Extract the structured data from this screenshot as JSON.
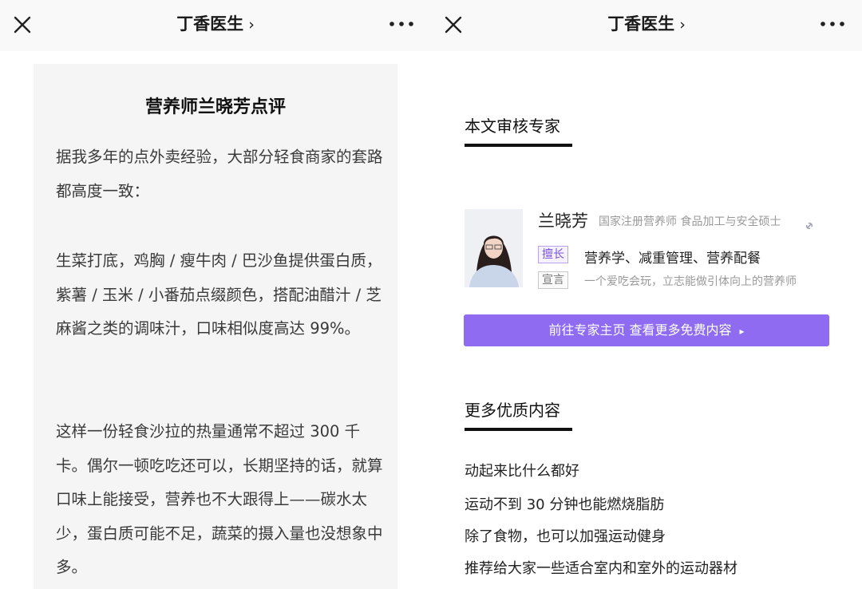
{
  "left_panel": {
    "header": {
      "title": "丁香医生",
      "chevron": "›"
    },
    "article": {
      "title": "营养师兰晓芳点评",
      "paragraphs": [
        "据我多年的点外卖经验，大部分轻食商家的套路都高度一致：",
        "生菜打底，鸡胸 / 瘦牛肉 / 巴沙鱼提供蛋白质，紫薯 / 玉米 / 小番茄点缀颜色，搭配油醋汁 / 芝麻酱之类的调味汁，口味相似度高达 99%。",
        "这样一份轻食沙拉的热量通常不超过 300 千卡。偶尔一顿吃吃还可以，长期坚持的话，就算口味上能接受，营养也不大跟得上——碳水太少，蛋白质可能不足，蔬菜的摄入量也没想象中多。"
      ]
    }
  },
  "right_panel": {
    "header": {
      "title": "丁香医生",
      "chevron": "›"
    },
    "reviewer_section": {
      "heading": "本文审核专家",
      "expert": {
        "name": "兰晓芳",
        "titles": "国家注册营养师  食品加工与安全硕士",
        "expertise_tag": "擅长",
        "expertise": "营养学、减重管理、营养配餐",
        "motto_tag": "宣言",
        "motto": "一个爱吃会玩，立志能做引体向上的营养师"
      },
      "cta": {
        "label": "前往专家主页  查看更多免费内容",
        "arrow": "▸"
      }
    },
    "more_section": {
      "heading": "更多优质内容",
      "items": [
        "动起来比什么都好",
        "运动不到 30 分钟也能燃烧脂肪",
        "除了食物，也可以加强运动健身",
        "推荐给大家一些适合室内和室外的运动器材"
      ]
    }
  },
  "icons": {
    "close": "close-icon",
    "more": "more-dots-icon",
    "link": "link-icon",
    "avatar": "avatar"
  },
  "colors": {
    "accent": "#8e6bf0",
    "header_bg": "#f9f9f9",
    "card_bg": "#f5f5f5",
    "body_text": "#3a3a3a",
    "muted_text": "#999999"
  }
}
